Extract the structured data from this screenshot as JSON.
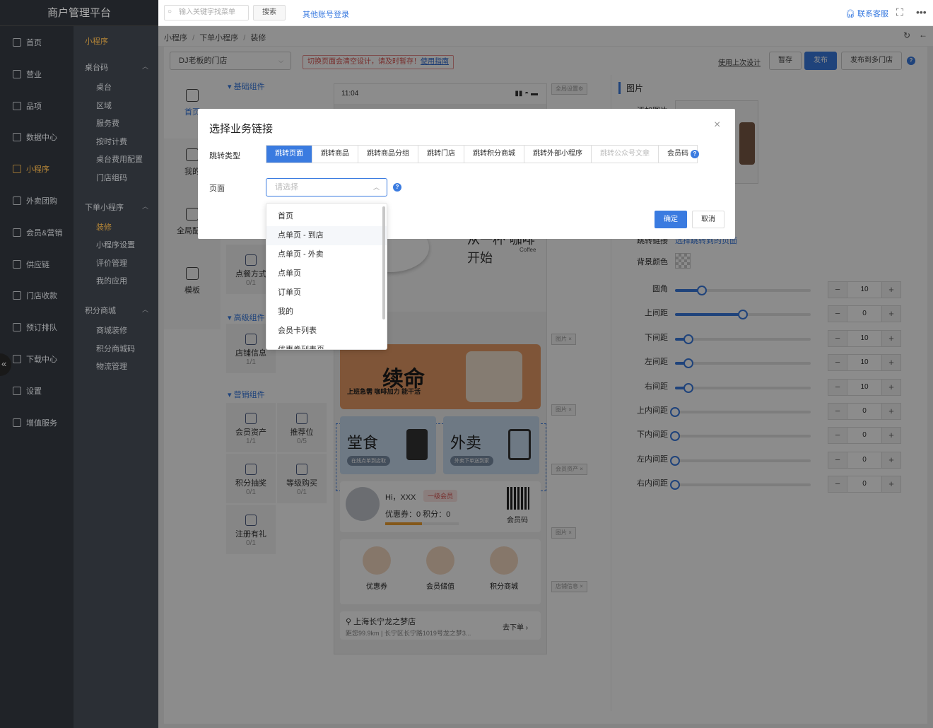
{
  "app": {
    "title": "商户管理平台"
  },
  "topbar": {
    "search_placeholder": "输入关键字找菜单",
    "search_btn": "搜索",
    "other_login": "其他账号登录",
    "support": "联系客服",
    "more": "•••",
    "fullscreen": "⛶"
  },
  "nav": [
    {
      "label": "首页",
      "active": false
    },
    {
      "label": "营业",
      "active": false
    },
    {
      "label": "品项",
      "active": false
    },
    {
      "label": "数据中心",
      "active": false
    },
    {
      "label": "小程序",
      "active": true
    },
    {
      "label": "外卖团购",
      "active": false
    },
    {
      "label": "会员&营销",
      "active": false
    },
    {
      "label": "供应链",
      "active": false
    },
    {
      "label": "门店收款",
      "active": false
    },
    {
      "label": "预订排队",
      "active": false
    },
    {
      "label": "下载中心",
      "active": false
    },
    {
      "label": "设置",
      "active": false
    },
    {
      "label": "增值服务",
      "active": false
    }
  ],
  "subnav": {
    "header": "小程序",
    "groups": [
      {
        "label": "桌台码",
        "items": [
          "桌台",
          "区域",
          "服务费",
          "按时计费",
          "桌台费用配置",
          "门店组码"
        ]
      },
      {
        "label": "下单小程序",
        "items": [
          "装修",
          "小程序设置",
          "评价管理",
          "我的应用"
        ]
      },
      {
        "label": "积分商城",
        "items": [
          "商城装修",
          "积分商城码",
          "物流管理"
        ]
      }
    ],
    "active_item": "装修"
  },
  "breadcrumb": {
    "a": "小程序",
    "b": "下单小程序",
    "c": "装修",
    "sep": "/"
  },
  "toolbar": {
    "store": "DJ老板的门店",
    "warning": "切换页面会清空设计，请及时暂存！",
    "guide": "使用指南",
    "last_design": "使用上次设计",
    "save": "暂存",
    "publish": "发布",
    "publish_multi": "发布到多门店"
  },
  "vtabs": [
    {
      "label": "首页"
    },
    {
      "label": "我的"
    },
    {
      "label": "全局配置"
    },
    {
      "label": "模板"
    }
  ],
  "palette": {
    "basic": "基础组件",
    "advanced": "高级组件",
    "marketing": "营销组件",
    "cells": [
      {
        "label": "点餐方式",
        "count": "0/1"
      },
      {
        "label": "店铺信息",
        "count": "1/1"
      },
      {
        "label": "会员资产",
        "count": "1/1"
      },
      {
        "label": "推荐位",
        "count": "0/5"
      },
      {
        "label": "积分抽奖",
        "count": "0/1"
      },
      {
        "label": "等级购买",
        "count": "0/1"
      },
      {
        "label": "注册有礼",
        "count": "0/1"
      }
    ]
  },
  "phone": {
    "time": "11:04",
    "global": "全局设置⚙",
    "coffee_text": "从一杯 咖啡 开始",
    "coffee_en": "Coffee",
    "banner": "续命",
    "banner_sub": "上班急需 咖啡加力 能干活",
    "dine": "堂食",
    "dine_sub": "在线点单到店取",
    "takeaway": "外卖",
    "takeaway_sub": "外卖下单送到家",
    "hi": "Hi，XXX",
    "level": "一级会员",
    "coupon": "优惠券：0  积分：0",
    "qrcode": "会员码",
    "icons": [
      "优惠券",
      "会员储值",
      "积分商城"
    ],
    "store_name": "上海长宁龙之梦店",
    "store_addr": "距您99.9km | 长宁区长宁路1019号龙之梦3...",
    "order": "去下单 ›",
    "tags": [
      "图片 ×",
      "图片 ×",
      "会员资产 ×",
      "图片 ×",
      "店铺信息 ×"
    ]
  },
  "rpanel": {
    "title": "图片",
    "add_img": "添加图片",
    "jump": "跳转链接",
    "jump_val": "选择跳转到的页面",
    "bg": "背景颜色",
    "rows": [
      {
        "label": "圆角",
        "value": 10,
        "max": 100
      },
      {
        "label": "上间距",
        "value": 0,
        "max": 100
      },
      {
        "label": "下间距",
        "value": 10,
        "max": 100
      },
      {
        "label": "左间距",
        "value": 10,
        "max": 100
      },
      {
        "label": "右间距",
        "value": 10,
        "max": 100
      },
      {
        "label": "上内间距",
        "value": 0,
        "max": 100
      },
      {
        "label": "下内间距",
        "value": 0,
        "max": 100
      },
      {
        "label": "左内间距",
        "value": 0,
        "max": 100
      },
      {
        "label": "右内间距",
        "value": 0,
        "max": 100
      }
    ],
    "row_fill": [
      0.2,
      0.5,
      0.1,
      0.1,
      0.1,
      0,
      0,
      0,
      0
    ]
  },
  "modal": {
    "title": "选择业务链接",
    "close": "×",
    "type_label": "跳转类型",
    "types": [
      {
        "label": "跳转页面",
        "state": "on"
      },
      {
        "label": "跳转商品",
        "state": ""
      },
      {
        "label": "跳转商品分组",
        "state": ""
      },
      {
        "label": "跳转门店",
        "state": ""
      },
      {
        "label": "跳转积分商城",
        "state": ""
      },
      {
        "label": "跳转外部小程序",
        "state": ""
      },
      {
        "label": "跳转公众号文章",
        "state": "dis"
      },
      {
        "label": "会员码",
        "state": ""
      }
    ],
    "page_label": "页面",
    "page_placeholder": "请选择",
    "ok": "确定",
    "cancel": "取消",
    "options": [
      "首页",
      "点单页 - 到店",
      "点单页 - 外卖",
      "点单页",
      "订单页",
      "我的",
      "会员卡列表",
      "优惠券列表页"
    ],
    "hover_index": 1
  },
  "colors": {
    "accent": "#3a7be0",
    "active_nav": "#f0b24a"
  }
}
